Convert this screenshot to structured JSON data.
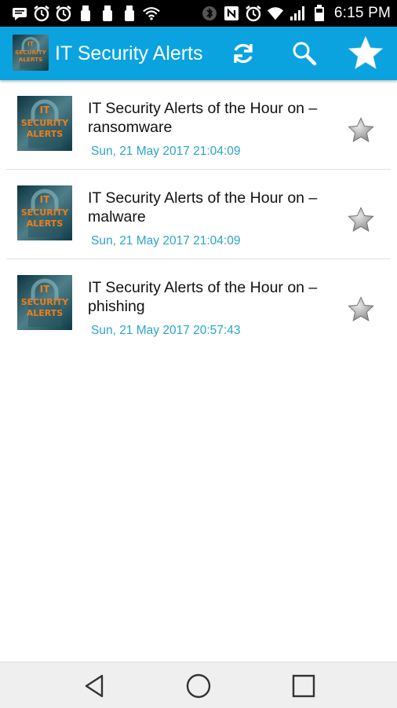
{
  "status_bar": {
    "time": "6:15 PM",
    "icons": [
      "message-icon",
      "alarm-icon",
      "alarm-icon",
      "usb-icon",
      "usb-icon",
      "usb-icon",
      "wifi-icon",
      "bluetooth-icon",
      "nfc-icon",
      "alarm-icon",
      "wifi-icon",
      "signal-icon",
      "battery-icon"
    ]
  },
  "app_bar": {
    "title": "IT Security Alerts",
    "logo_text": [
      "IT",
      "SECURITY",
      "ALERTS"
    ],
    "background": "#0aa3e0",
    "actions": [
      "refresh-icon",
      "search-icon",
      "favorites-star-icon"
    ]
  },
  "alerts": [
    {
      "title": "IT Security Alerts of the Hour on – ransomware",
      "date": "Sun, 21 May 2017 21:04:09"
    },
    {
      "title": "IT Security Alerts of the Hour on – malware",
      "date": "Sun, 21 May 2017 21:04:09"
    },
    {
      "title": "IT Security Alerts of the Hour on – phishing",
      "date": "Sun, 21 May 2017 20:57:43"
    }
  ],
  "colors": {
    "date_text": "#29a5c9",
    "title_text": "#111111",
    "thumb_text": "#f07d1a"
  },
  "nav_bar": {
    "buttons": [
      "back-icon",
      "home-icon",
      "recents-icon"
    ]
  }
}
